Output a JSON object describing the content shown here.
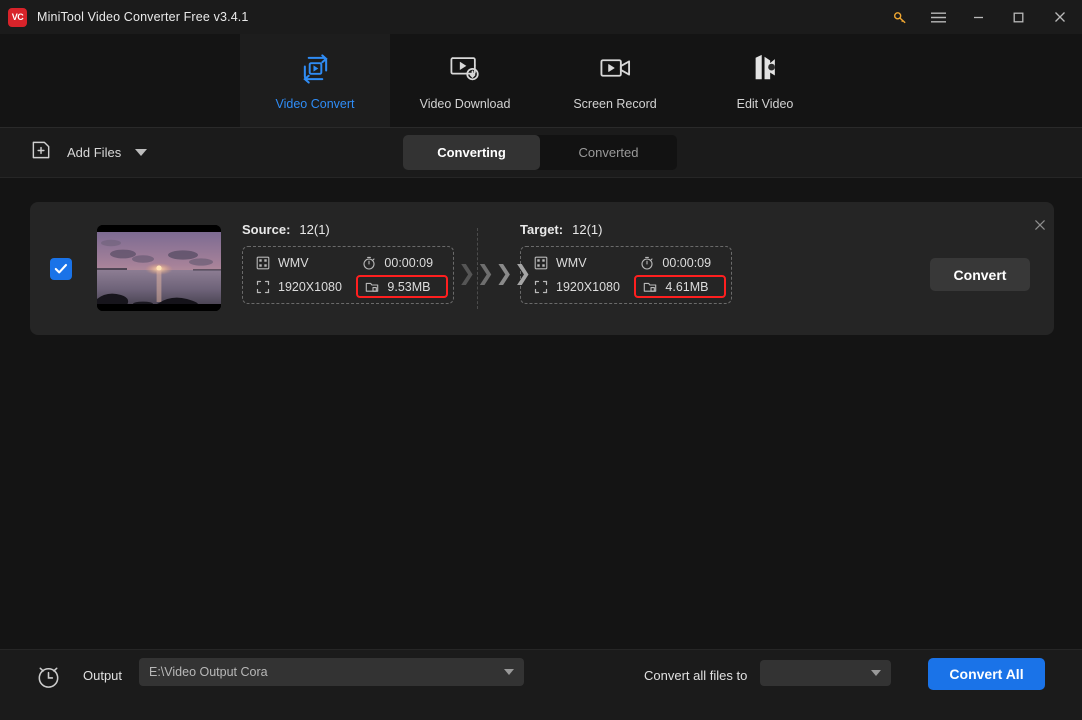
{
  "window": {
    "title": "MiniTool Video Converter Free v3.4.1",
    "logo_text": "VC",
    "controls": [
      {
        "name": "key-icon",
        "label": "⚿"
      },
      {
        "name": "hamburger-menu-icon",
        "label": "☰"
      },
      {
        "name": "minimize-icon",
        "label": "—"
      },
      {
        "name": "maximize-icon",
        "label": "□"
      },
      {
        "name": "close-icon",
        "label": "✕"
      }
    ]
  },
  "nav": {
    "items": [
      {
        "label": "Video Convert",
        "icon": "video-convert-icon",
        "active": true
      },
      {
        "label": "Video Download",
        "icon": "video-download-icon",
        "active": false
      },
      {
        "label": "Screen Record",
        "icon": "screen-record-icon",
        "active": false
      },
      {
        "label": "Edit Video",
        "icon": "edit-video-icon",
        "active": false
      }
    ]
  },
  "toolbar": {
    "add_files_label": "Add Files",
    "add_files_icon": "add-folder-icon",
    "tabs": [
      {
        "label": "Converting",
        "active": true
      },
      {
        "label": "Converted",
        "active": false
      }
    ]
  },
  "file_card": {
    "selected": true,
    "thumbnail_alt": "sunset-over-ocean-thumbnail",
    "source": {
      "heading": "Source:",
      "name": "12(1)",
      "format": "WMV",
      "duration": "00:00:09",
      "resolution": "1920X1080",
      "size": "9.53MB",
      "size_highlighted": true
    },
    "target": {
      "heading": "Target:",
      "name": "12(1)",
      "format": "WMV",
      "duration": "00:00:09",
      "resolution": "1920X1080",
      "size": "4.61MB",
      "size_highlighted": true
    },
    "convert_button": "Convert",
    "edit_icon": "edit-square-icon",
    "expand_icon": "cursor-in-box-icon",
    "close_icon": "close-icon"
  },
  "bottom": {
    "clock_icon": "alarm-clock-icon",
    "output_label": "Output",
    "output_path": "E:\\Video Output Cora",
    "convert_all_label": "Convert all files to",
    "format_selected": "",
    "convert_all_button": "Convert All"
  },
  "colors": {
    "accent_blue": "#1a73e8",
    "nav_active_blue": "#2f8cf5",
    "highlight_red": "#ff1f1f",
    "logo_red": "#d8232a",
    "key_gold": "#f0a732",
    "page_bg": "#141414",
    "card_bg": "#252525",
    "bar_bg": "#1b1b1b"
  }
}
